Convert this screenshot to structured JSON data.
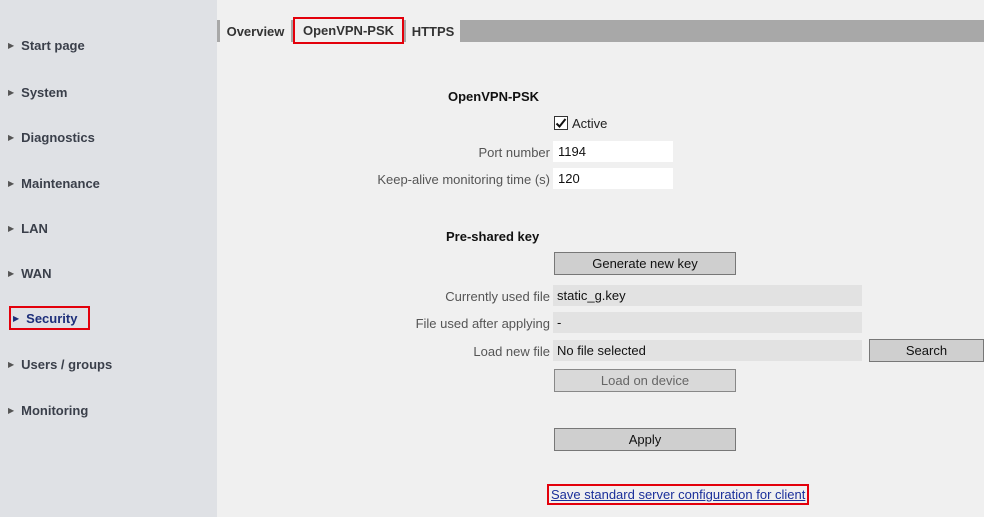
{
  "sidebar": {
    "items": [
      {
        "label": "Start page"
      },
      {
        "label": "System"
      },
      {
        "label": "Diagnostics"
      },
      {
        "label": "Maintenance"
      },
      {
        "label": "LAN"
      },
      {
        "label": "WAN"
      },
      {
        "label": "Security",
        "active": true
      },
      {
        "label": "Users / groups"
      },
      {
        "label": "Monitoring"
      }
    ]
  },
  "tabs": [
    {
      "label": "Overview"
    },
    {
      "label": "OpenVPN-PSK",
      "active": true
    },
    {
      "label": "HTTPS"
    }
  ],
  "openvpn": {
    "section_title": "OpenVPN-PSK",
    "active_label": "Active",
    "active_checked": true,
    "port_label": "Port number",
    "port_value": "1194",
    "keepalive_label": "Keep-alive monitoring time (s)",
    "keepalive_value": "120"
  },
  "psk": {
    "section_title": "Pre-shared key",
    "generate_button": "Generate new key",
    "current_file_label": "Currently used file",
    "current_file_value": "static_g.key",
    "after_apply_label": "File used after applying",
    "after_apply_value": "-",
    "load_new_label": "Load new file",
    "load_new_value": "No file selected",
    "search_button": "Search",
    "load_device_button": "Load on device"
  },
  "apply_button": "Apply",
  "save_config_link": "Save standard server configuration for client",
  "colors": {
    "highlight_border": "#e3000b",
    "sidebar_bg": "#dfe1e5",
    "link": "#1a2f9a"
  }
}
